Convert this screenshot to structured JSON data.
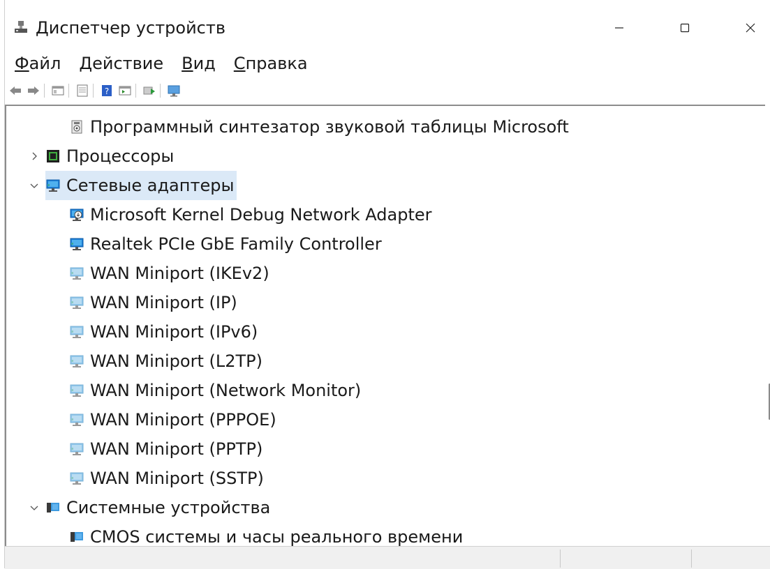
{
  "window": {
    "title": "Диспетчер устройств",
    "title_icon": "device-manager-icon"
  },
  "window_controls": {
    "minimize": "–",
    "maximize": "☐",
    "close": "✕"
  },
  "menu": [
    {
      "acc": "Ф",
      "rest": "айл"
    },
    {
      "acc": "Д",
      "rest": "ействие"
    },
    {
      "acc": "В",
      "rest": "ид"
    },
    {
      "acc": "С",
      "rest": "правка"
    }
  ],
  "toolbar": [
    "back-arrow-icon",
    "forward-arrow-icon",
    "show-hide-console-tree-icon",
    "properties-icon",
    "help-icon",
    "run-action-icon",
    "update-driver-icon",
    "scan-hardware-icon"
  ],
  "tree": [
    {
      "label": "Программный синтезатор звуковой таблицы Microsoft",
      "indent": 2,
      "icon": "audio-device-icon",
      "chevron": ""
    },
    {
      "label": "Процессоры",
      "indent": 1,
      "icon": "processor-icon",
      "chevron": "›"
    },
    {
      "label": "Сетевые адаптеры",
      "indent": 1,
      "icon": "network-adapter-icon",
      "chevron": "⌄",
      "selected": true
    },
    {
      "label": "Microsoft Kernel Debug Network Adapter",
      "indent": 2,
      "icon": "network-adapter-debug-icon",
      "chevron": ""
    },
    {
      "label": "Realtek PCIe GbE Family Controller",
      "indent": 2,
      "icon": "network-adapter-icon",
      "chevron": ""
    },
    {
      "label": "WAN Miniport (IKEv2)",
      "indent": 2,
      "icon": "wan-miniport-icon",
      "chevron": ""
    },
    {
      "label": "WAN Miniport (IP)",
      "indent": 2,
      "icon": "wan-miniport-icon",
      "chevron": ""
    },
    {
      "label": "WAN Miniport (IPv6)",
      "indent": 2,
      "icon": "wan-miniport-icon",
      "chevron": ""
    },
    {
      "label": "WAN Miniport (L2TP)",
      "indent": 2,
      "icon": "wan-miniport-icon",
      "chevron": ""
    },
    {
      "label": "WAN Miniport (Network Monitor)",
      "indent": 2,
      "icon": "wan-miniport-icon",
      "chevron": ""
    },
    {
      "label": "WAN Miniport (PPPOE)",
      "indent": 2,
      "icon": "wan-miniport-icon",
      "chevron": ""
    },
    {
      "label": "WAN Miniport (PPTP)",
      "indent": 2,
      "icon": "wan-miniport-icon",
      "chevron": ""
    },
    {
      "label": "WAN Miniport (SSTP)",
      "indent": 2,
      "icon": "wan-miniport-icon",
      "chevron": ""
    },
    {
      "label": "Системные устройства",
      "indent": 1,
      "icon": "system-devices-icon",
      "chevron": "⌄"
    },
    {
      "label": "CMOS системы и часы реального времени",
      "indent": 2,
      "icon": "system-devices-icon",
      "chevron": ""
    }
  ],
  "colors": {
    "selection": "#dbe9f7",
    "monitor_blue": "#1e7fd6",
    "monitor_teal": "#3aa6a0"
  }
}
